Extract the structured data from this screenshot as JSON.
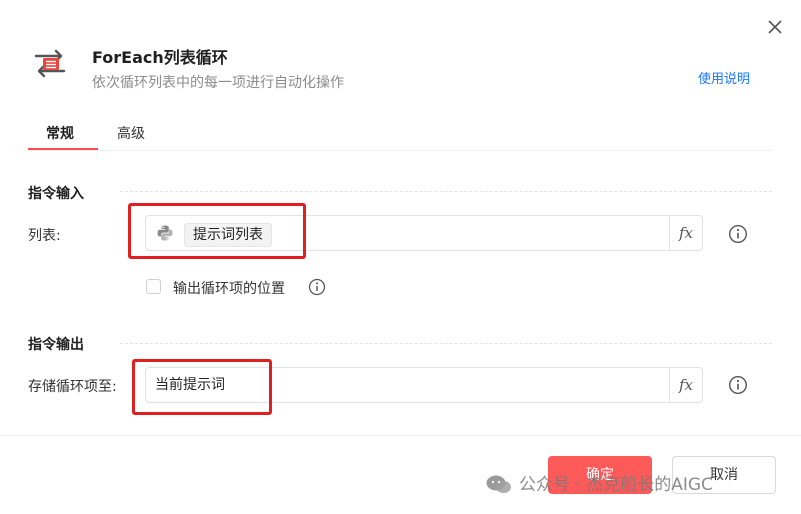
{
  "header": {
    "title": "ForEach列表循环",
    "subtitle": "依次循环列表中的每一项进行自动化操作",
    "help_link": "使用说明",
    "icon": "loop-list-icon",
    "close_icon": "close-icon"
  },
  "tabs": [
    {
      "label": "常规",
      "active": true
    },
    {
      "label": "高级",
      "active": false
    }
  ],
  "input_section": {
    "title": "指令输入",
    "list_field": {
      "label": "列表:",
      "value_tag": "提示词列表",
      "value_icon": "python-icon",
      "fx_label": "fx"
    },
    "checkbox": {
      "label": "输出循环项的位置",
      "checked": false
    }
  },
  "output_section": {
    "title": "指令输出",
    "store_field": {
      "label": "存储循环项至:",
      "value": "当前提示词",
      "fx_label": "fx"
    }
  },
  "footer": {
    "ok_label": "确定",
    "cancel_label": "取消"
  },
  "watermark": {
    "text": "公众号 · 杰克船长的AIGC"
  },
  "colors": {
    "accent": "#ff5a5a",
    "link": "#1677ff",
    "annotation_red": "#e02020",
    "icon_red": "#e8453c"
  }
}
